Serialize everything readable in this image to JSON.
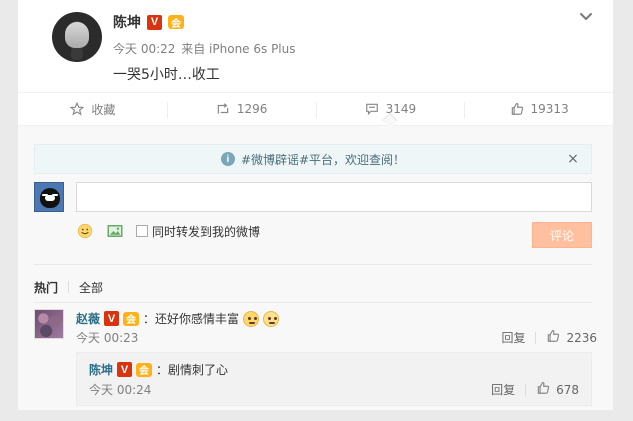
{
  "post": {
    "author": "陈坤",
    "badges": {
      "v": "V",
      "vip": "会"
    },
    "time": "今天 00:22",
    "source": "来自 iPhone 6s Plus",
    "text": "一哭5小时…收工"
  },
  "actions": {
    "favorite": "收藏",
    "reposts": "1296",
    "comments": "3149",
    "likes": "19313"
  },
  "comments_panel": {
    "notice": "#微博辟谣#平台，欢迎查阅！",
    "input_placeholder": "",
    "forward_label": "同时转发到我的微博",
    "submit_label": "评论",
    "filter_hot": "热门",
    "filter_all": "全部"
  },
  "comments": [
    {
      "name": "赵薇",
      "badges": {
        "v": "V",
        "vip": "会"
      },
      "text": "：还好你感情丰富",
      "time": "今天 00:23",
      "reply_label": "回复",
      "likes": "2236",
      "replies": [
        {
          "name": "陈坤",
          "badges": {
            "v": "V",
            "vip": "会"
          },
          "text": "：剧情刺了心",
          "time": "今天 00:24",
          "reply_label": "回复",
          "likes": "678"
        }
      ]
    }
  ],
  "colors": {
    "accent_name": "#2b6f89",
    "badge_red": "#d9340f",
    "badge_orange": "#ffb11a",
    "notice_bg": "#eef6f7",
    "submit_bg": "#ffc09f"
  },
  "icons": {
    "more": "chevron-down-icon",
    "favorite": "star-icon",
    "repost": "repost-icon",
    "comment": "comment-icon",
    "like": "thumb-up-icon",
    "emoji": "emoji-icon",
    "image": "image-icon",
    "info": "info-icon",
    "close": "close-icon"
  }
}
